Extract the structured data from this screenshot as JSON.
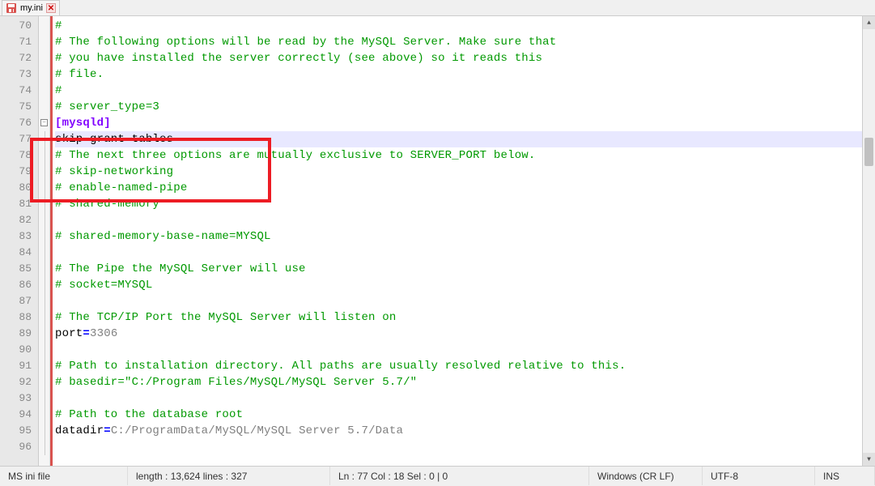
{
  "tab": {
    "filename": "my.ini"
  },
  "gutter": {
    "start": 70,
    "count": 27
  },
  "code": {
    "lines": [
      {
        "type": "comment",
        "text": "#"
      },
      {
        "type": "comment",
        "text": "# The following options will be read by the MySQL Server. Make sure that"
      },
      {
        "type": "comment",
        "text": "# you have installed the server correctly (see above) so it reads this "
      },
      {
        "type": "comment",
        "text": "# file."
      },
      {
        "type": "comment",
        "text": "#"
      },
      {
        "type": "comment",
        "text": "# server_type=3"
      },
      {
        "type": "section",
        "text": "[mysqld]",
        "fold": true
      },
      {
        "type": "key",
        "text": "skip-grant-tables",
        "highlight": true
      },
      {
        "type": "comment",
        "text": "# The next three options are mutually exclusive to SERVER_PORT below."
      },
      {
        "type": "comment",
        "text": "# skip-networking"
      },
      {
        "type": "comment",
        "text": "# enable-named-pipe"
      },
      {
        "type": "comment",
        "text": "# shared-memory"
      },
      {
        "type": "blank",
        "text": ""
      },
      {
        "type": "comment",
        "text": "# shared-memory-base-name=MYSQL"
      },
      {
        "type": "blank",
        "text": ""
      },
      {
        "type": "comment",
        "text": "# The Pipe the MySQL Server will use"
      },
      {
        "type": "comment",
        "text": "# socket=MYSQL"
      },
      {
        "type": "blank",
        "text": ""
      },
      {
        "type": "comment",
        "text": "# The TCP/IP Port the MySQL Server will listen on"
      },
      {
        "type": "kv",
        "key": "port",
        "value": "3306"
      },
      {
        "type": "blank",
        "text": ""
      },
      {
        "type": "comment",
        "text": "# Path to installation directory. All paths are usually resolved relative to this."
      },
      {
        "type": "comment",
        "text": "# basedir=\"C:/Program Files/MySQL/MySQL Server 5.7/\""
      },
      {
        "type": "blank",
        "text": ""
      },
      {
        "type": "comment",
        "text": "# Path to the database root"
      },
      {
        "type": "kv",
        "key": "datadir",
        "value": "C:/ProgramData/MySQL/MySQL Server 5.7/Data"
      },
      {
        "type": "blank",
        "text": ""
      }
    ]
  },
  "status": {
    "filetype": "MS ini file",
    "length_label": "length : 13,624    lines : 327",
    "position_label": "Ln : 77    Col : 18    Sel : 0 | 0",
    "eol": "Windows (CR LF)",
    "encoding": "UTF-8",
    "mode": "INS"
  }
}
